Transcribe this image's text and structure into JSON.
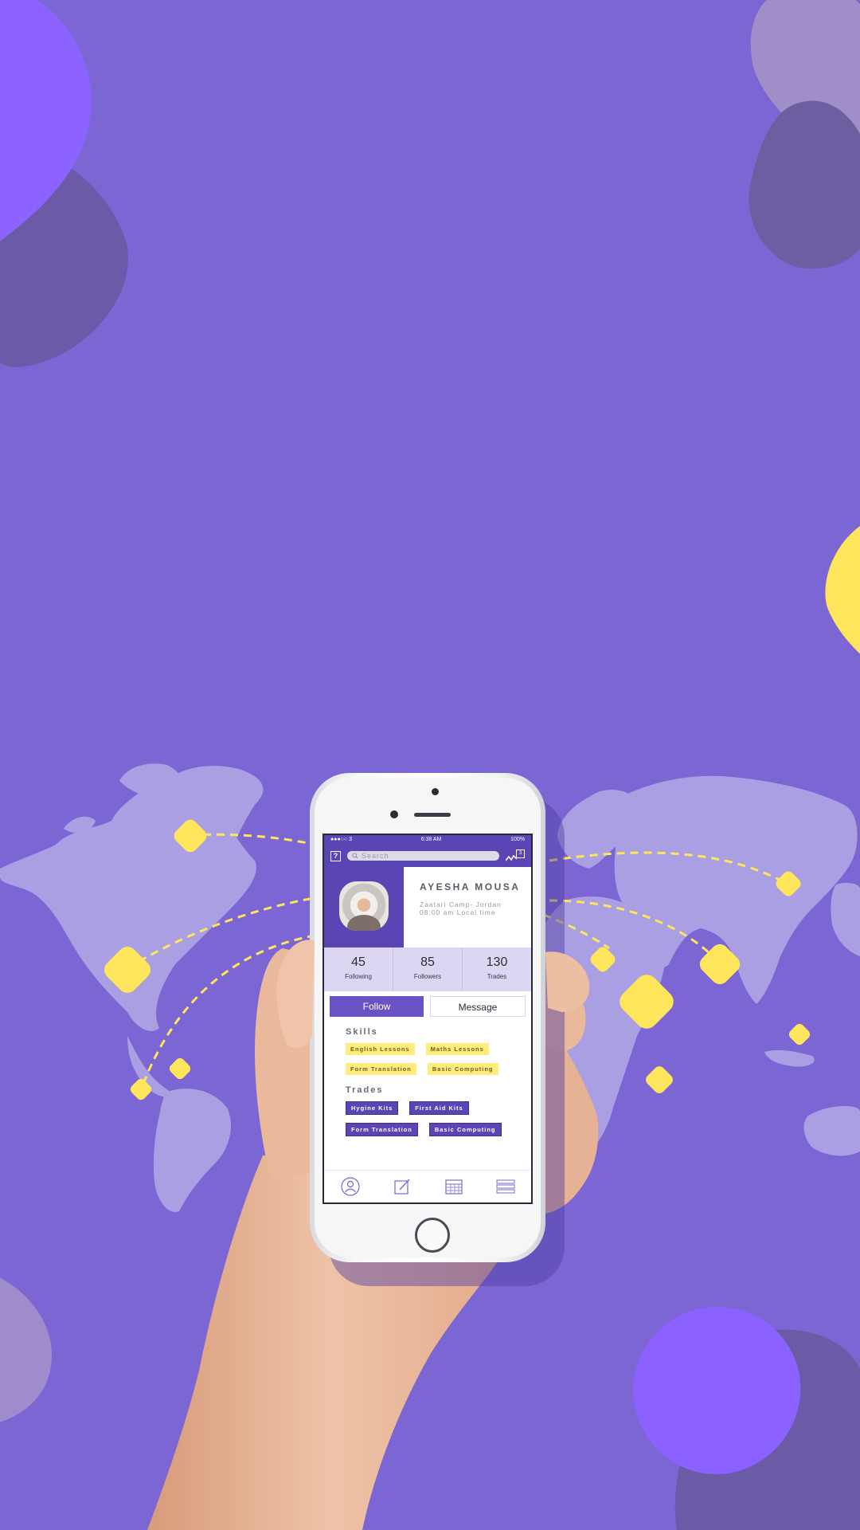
{
  "colors": {
    "background": "#7b66d3",
    "primary": "#5b45b5",
    "accent_yellow": "#ffec5c",
    "map": "#ab9fe3"
  },
  "status_bar": {
    "carrier": "●●●○○ 3",
    "time": "6:38 AM",
    "battery": "100%"
  },
  "header": {
    "help_icon": "question-icon",
    "search_placeholder": "Search",
    "notification_count": "3"
  },
  "profile": {
    "name": "AYESHA MOUSA",
    "location": "Zaatari Camp- Jordan",
    "local_time": "08:00 am Local time"
  },
  "stats": [
    {
      "value": "45",
      "label": "Following"
    },
    {
      "value": "85",
      "label": "Followers"
    },
    {
      "value": "130",
      "label": "Trades"
    }
  ],
  "actions": {
    "follow_label": "Follow",
    "message_label": "Message"
  },
  "skills": {
    "title": "Skills",
    "items": [
      "English Lessons",
      "Maths Lessons",
      "Form Translation",
      "Basic Computing"
    ]
  },
  "trades": {
    "title": "Trades",
    "items": [
      "Hygine Kits",
      "First Aid Kits",
      "Form Translation",
      "Basic Computing"
    ]
  },
  "tabbar": [
    "profile-icon",
    "edit-icon",
    "calendar-icon",
    "list-icon"
  ]
}
